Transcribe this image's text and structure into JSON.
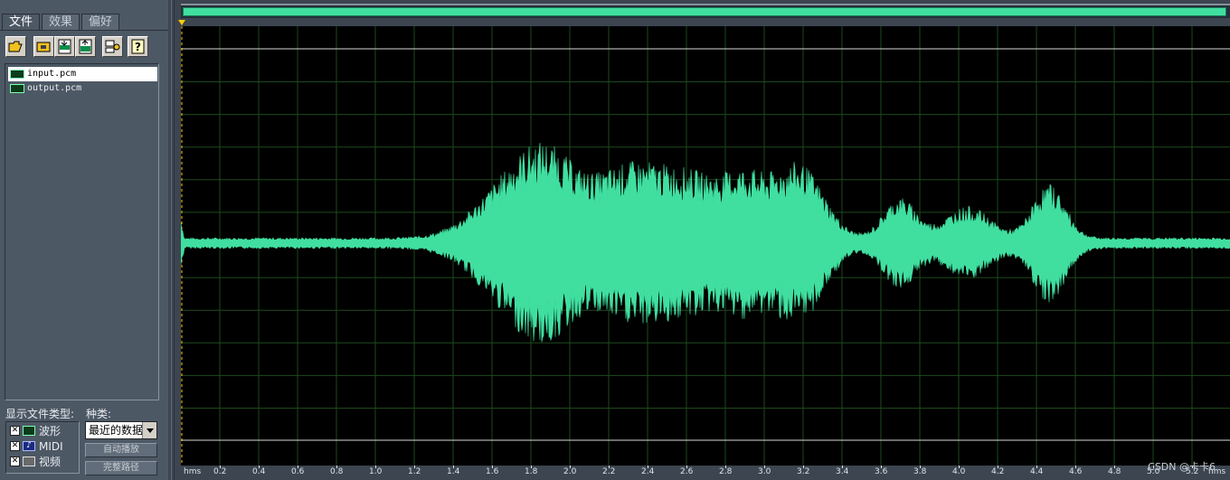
{
  "tabs": [
    {
      "label": "文件",
      "active": true
    },
    {
      "label": "效果",
      "active": false
    },
    {
      "label": "偏好",
      "active": false
    }
  ],
  "toolbar": [
    {
      "name": "open-file-icon"
    },
    {
      "name": "open-folder-icon"
    },
    {
      "name": "import-icon"
    },
    {
      "name": "export-icon"
    },
    {
      "name": "batch-icon"
    },
    {
      "name": "help-icon"
    }
  ],
  "files": [
    {
      "name": "input.pcm",
      "selected": true
    },
    {
      "name": "output.pcm",
      "selected": false
    }
  ],
  "filter": {
    "label": "显示文件类型:",
    "kind_label": "种类:",
    "types": [
      {
        "label": "波形",
        "checked": true,
        "icon": "waveform-icon"
      },
      {
        "label": "MIDI",
        "checked": true,
        "icon": "midi-icon"
      },
      {
        "label": "视频",
        "checked": true,
        "icon": "video-icon"
      }
    ],
    "recent_select": "最近的数据",
    "auto_play_button": "自动播放",
    "full_path_button": "完整路径"
  },
  "colors": {
    "waveform": "#40dfa0",
    "background": "#000000",
    "grid": "#1d4a1d",
    "panel": "#4d5865"
  },
  "timeline": {
    "unit_label_left": "hms",
    "unit_label_right": "hms",
    "ticks": [
      "0.2",
      "0.4",
      "0.6",
      "0.8",
      "1.0",
      "1.2",
      "1.4",
      "1.6",
      "1.8",
      "2.0",
      "2.2",
      "2.4",
      "2.6",
      "2.8",
      "3.0",
      "3.2",
      "3.4",
      "3.6",
      "3.8",
      "4.0",
      "4.2",
      "4.4",
      "4.6",
      "4.8",
      "5.0",
      "5.2"
    ]
  },
  "watermark": "CSDN @卡卡6"
}
